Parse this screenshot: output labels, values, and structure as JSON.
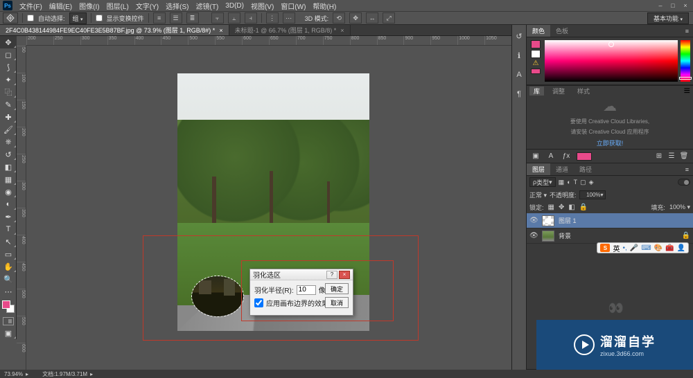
{
  "app": {
    "logo": "Ps"
  },
  "menu": [
    "文件(F)",
    "编辑(E)",
    "图像(I)",
    "图层(L)",
    "文字(Y)",
    "选择(S)",
    "滤镜(T)",
    "3D(D)",
    "视图(V)",
    "窗口(W)",
    "帮助(H)"
  ],
  "window_controls": [
    "–",
    "□",
    "×"
  ],
  "optbar": {
    "auto_select_label": "自动选择:",
    "auto_select_value": "组",
    "show_transform": "显示变换控件",
    "mode3d": "3D 模式:"
  },
  "ext_tab": "基本功能",
  "tabs": [
    {
      "label": "2F4C0B438144984FE9EC40FE3E5B87BF.jpg @ 73.9% (图层 1, RGB/8#) *",
      "active": true
    },
    {
      "label": "未标题-1 @ 66.7% (图层 1, RGB/8) *",
      "active": false
    }
  ],
  "ruler_h": [
    "200",
    "250",
    "300",
    "350",
    "400",
    "450",
    "500",
    "550",
    "600",
    "650",
    "700",
    "750",
    "800",
    "850",
    "900",
    "950",
    "1000",
    "1050"
  ],
  "ruler_v": [
    "50",
    "100",
    "150",
    "200",
    "250",
    "300",
    "350",
    "400",
    "450",
    "500",
    "550",
    "600"
  ],
  "dialog": {
    "title": "羽化选区",
    "radius_label": "羽化半径(R):",
    "radius_value": "10",
    "radius_unit": "像素",
    "canvas_effect": "应用画布边界的效果",
    "ok": "确定",
    "cancel": "取消"
  },
  "panels": {
    "color": {
      "tabs": [
        "颜色",
        "色板"
      ],
      "active": 0,
      "fg": "#e84a8a",
      "bg": "#ffffff",
      "ring_left": "48%",
      "ring_top": "4%",
      "hue_pos": "88%"
    },
    "lib_tabs": [
      "库",
      "调整",
      "样式"
    ],
    "lib": {
      "line1": "要使用 Creative Cloud Libraries,",
      "line2": "请安装 Creative Cloud 应用程序",
      "link": "立即获取!"
    },
    "layers": {
      "tabs": [
        "图层",
        "通道",
        "路径"
      ],
      "kind": "类型",
      "blend_mode": "正常",
      "opacity_label": "不透明度:",
      "opacity": "100%",
      "lock_label": "锁定:",
      "fill_label": "填充:",
      "fill": "100%",
      "items": [
        {
          "name": "图层 1",
          "selected": true,
          "locked": false,
          "thumb": "mask"
        },
        {
          "name": "背景",
          "selected": false,
          "locked": true,
          "thumb": "bg"
        }
      ]
    }
  },
  "ime": {
    "badge": "S",
    "lang": "英"
  },
  "watermark": {
    "brand": "溜溜自学",
    "sub": "zixue.3d66.com"
  },
  "status": {
    "zoom": "73.94%",
    "docinfo": "文档:1.97M/3.71M"
  }
}
